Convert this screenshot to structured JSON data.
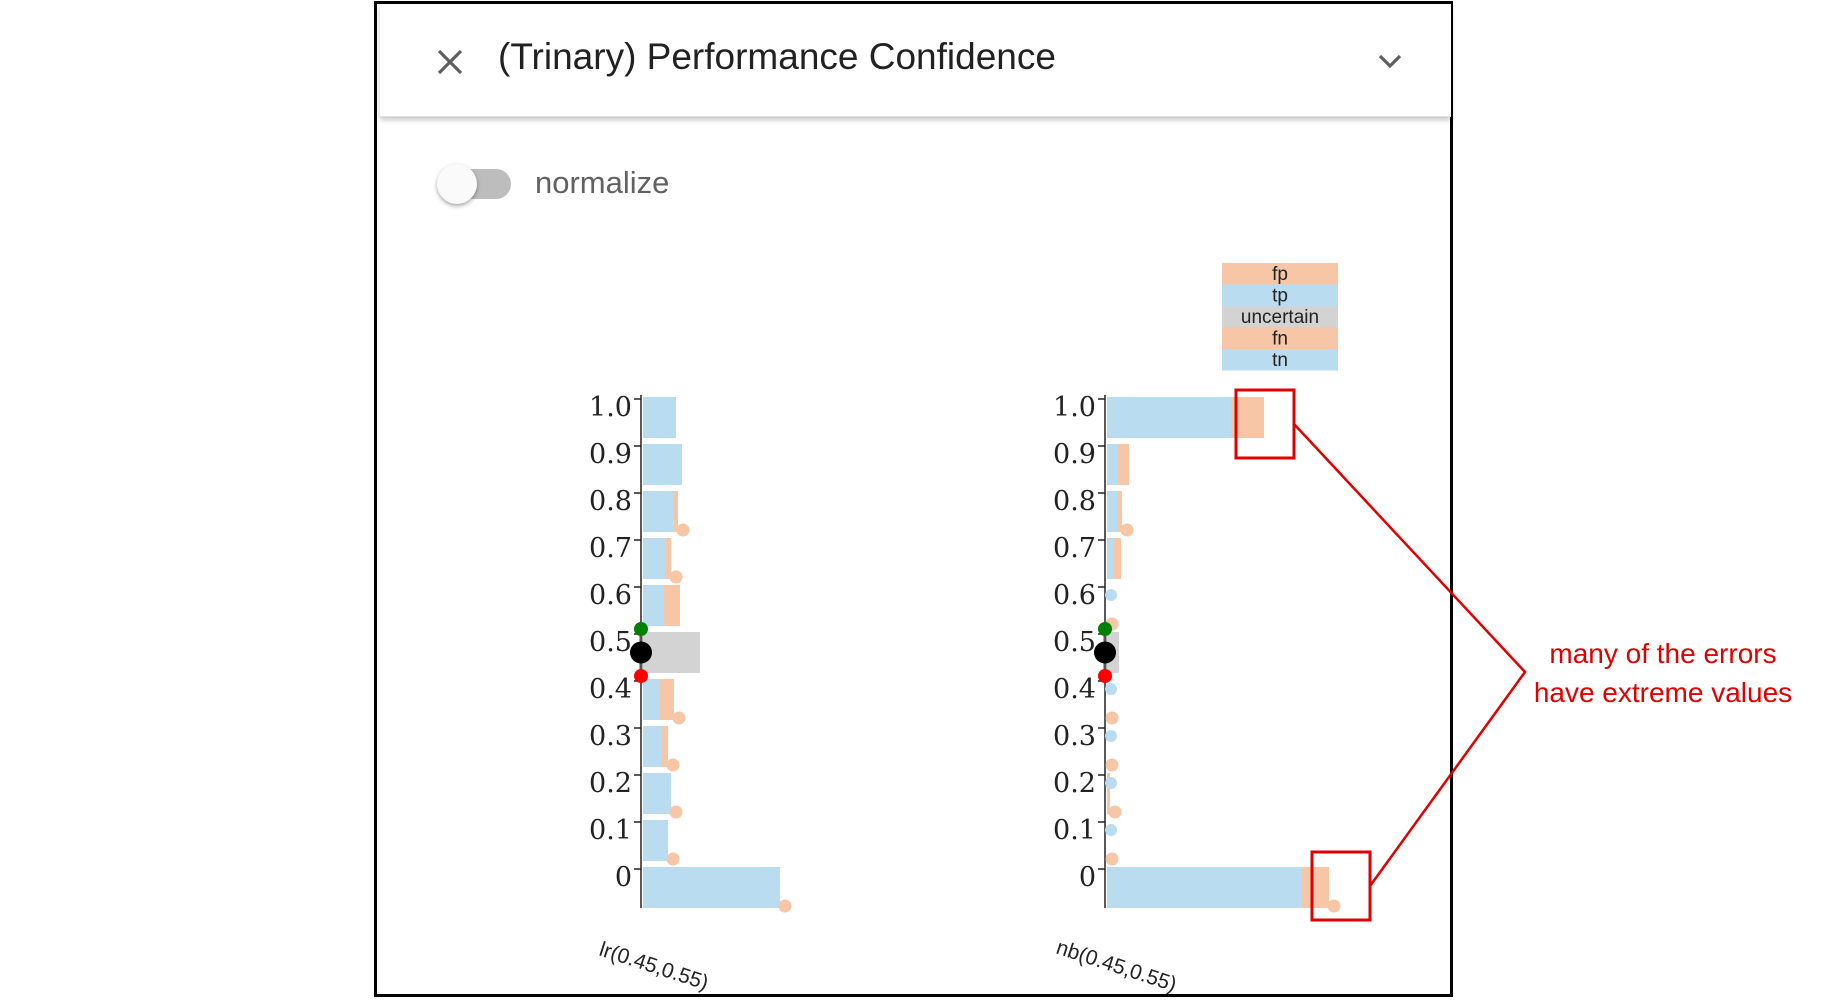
{
  "panel": {
    "title": "(Trinary) Performance Confidence",
    "close_icon": "close-icon",
    "collapse_icon": "chevron-down-icon"
  },
  "toggle": {
    "label": "normalize",
    "checked": false
  },
  "colors": {
    "tp": "#b9dcf1",
    "tn": "#b9dcf1",
    "fp": "#f6c6a7",
    "fn": "#f6c6a7",
    "uncertain": "#d3d3d3",
    "upper_threshold": "#008000",
    "lower_threshold": "#ff0000",
    "threshold_center": "#000000",
    "annotation": "#e00000"
  },
  "chart_data": [
    {
      "type": "bar",
      "orientation": "horizontal",
      "stacked": true,
      "xlabel": "lr(0.45,0.55)",
      "thresholds": {
        "lower": 0.45,
        "upper": 0.55
      },
      "categories": [
        "1.0",
        "0.9",
        "0.8",
        "0.7",
        "0.6",
        "0.5",
        "0.4",
        "0.3",
        "0.2",
        "0.1",
        "0"
      ],
      "series": [
        {
          "name": "tp/tn",
          "values": [
            33,
            39,
            31,
            23,
            21,
            0,
            17,
            19,
            28,
            25,
            137
          ]
        },
        {
          "name": "fp/fn",
          "values": [
            0,
            0,
            4,
            5,
            16,
            0,
            14,
            6,
            0,
            0,
            0
          ]
        },
        {
          "name": "uncertain",
          "values": [
            0,
            0,
            0,
            0,
            0,
            57,
            0,
            0,
            0,
            0,
            0
          ]
        }
      ],
      "small_error_markers": [
        0,
        0,
        1,
        1,
        0,
        0,
        1,
        1,
        1,
        1,
        1
      ]
    },
    {
      "type": "bar",
      "orientation": "horizontal",
      "stacked": true,
      "xlabel": "nb(0.45,0.55)",
      "thresholds": {
        "lower": 0.45,
        "upper": 0.55
      },
      "categories": [
        "1.0",
        "0.9",
        "0.8",
        "0.7",
        "0.6",
        "0.5",
        "0.4",
        "0.3",
        "0.2",
        "0.1",
        "0"
      ],
      "series": [
        {
          "name": "tp/tn",
          "values": [
            124,
            11,
            10,
            7,
            0,
            0,
            0,
            0,
            0,
            0,
            195
          ]
        },
        {
          "name": "fp/fn",
          "values": [
            33,
            11,
            5,
            7,
            0,
            0,
            0,
            0,
            3,
            0,
            27
          ]
        },
        {
          "name": "uncertain",
          "values": [
            0,
            0,
            0,
            0,
            0,
            12,
            0,
            0,
            0,
            0,
            0
          ]
        }
      ],
      "small_error_markers": [
        0,
        0,
        1,
        0,
        1,
        0,
        1,
        1,
        1,
        1,
        1
      ],
      "small_correct_markers": [
        0,
        0,
        0,
        0,
        1,
        0,
        1,
        1,
        1,
        1,
        0
      ]
    }
  ],
  "legend": [
    "fp",
    "tp",
    "uncertain",
    "fn",
    "tn"
  ],
  "annotation": {
    "line1": "many of the errors",
    "line2": "have extreme values"
  }
}
